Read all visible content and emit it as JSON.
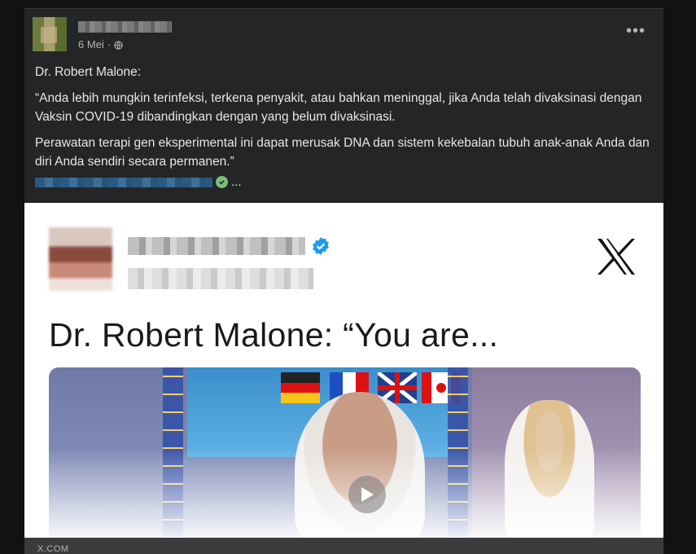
{
  "post": {
    "date": "6 Mei",
    "dot": "·",
    "more": "•••",
    "paragraphs": [
      "Dr. Robert Malone:",
      "“Anda lebih mungkin terinfeksi, terkena penyakit, atau bahkan meninggal, jika Anda telah divaksinasi dengan Vaksin COVID-19 dibandingkan dengan yang belum divaksinasi.",
      "Perawatan terapi gen eksperimental ini dapat merusak DNA dan sistem kekebalan tubuh anak-anak Anda dan diri Anda sendiri secara permanen.”"
    ],
    "ellipsis": "..."
  },
  "card": {
    "title": "Dr. Robert Malone: “You are...",
    "footer": "X.COM"
  },
  "colors": {
    "post_bg": "#242526",
    "text": "#e4e6eb",
    "muted": "#b0b3b8",
    "verified_blue": "#1d9bf0"
  },
  "icons": {
    "privacy": "globe-icon",
    "more": "more-options-icon",
    "verified": "verified-badge-icon",
    "brand": "x-logo-icon",
    "play": "play-icon"
  }
}
